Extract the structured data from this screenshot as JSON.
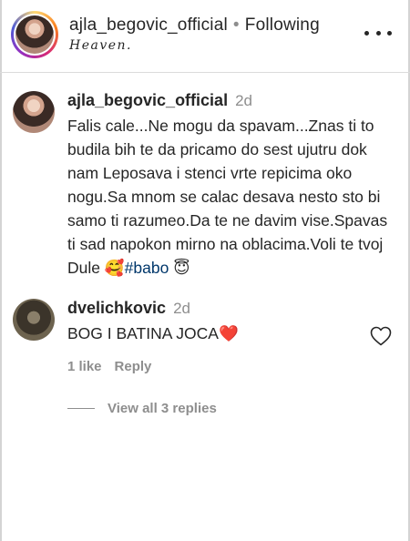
{
  "header": {
    "username": "ajla_begovic_official",
    "separator": "•",
    "follow_status": "Following",
    "subtitle": "Heaven."
  },
  "caption": {
    "username": "ajla_begovic_official",
    "time": "2d",
    "text_main": "Falis cale...Ne mogu da spavam...Znas ti to budila bih te da pricamo do sest ujutru dok nam Leposava i stenci vrte repicima oko nogu.Sa mnom se calac desava nesto sto bi samo ti razumeo.Da te ne davim vise.Spavas ti sad napokon mirno na oblacima.Voli te tvoj Dule ",
    "emoji_1": "🥰",
    "hashtag": "#babo",
    "emoji_2": "😇"
  },
  "comment": {
    "username": "dvelichkovic",
    "time": "2d",
    "text": "BOG I BATINA JOCA",
    "emoji": "❤️",
    "likes": "1 like",
    "reply_label": "Reply",
    "view_replies": "View all 3 replies"
  }
}
